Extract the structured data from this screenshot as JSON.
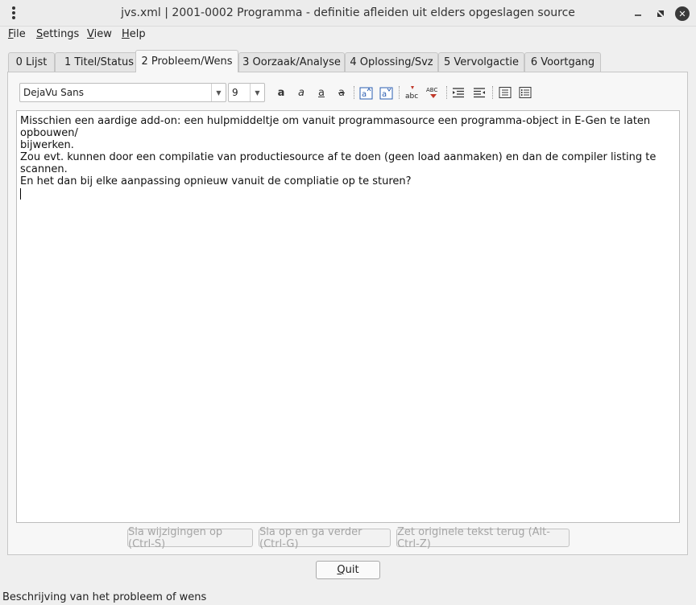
{
  "window": {
    "title": "jvs.xml | 2001-0002 Programma - definitie afleiden uit elders opgeslagen source"
  },
  "menu": [
    "File",
    "Settings",
    "View",
    "Help"
  ],
  "tabs": [
    {
      "label": "0 Lijst",
      "active": false
    },
    {
      "label": "1 Titel/Status",
      "active": false
    },
    {
      "label": "2 Probleem/Wens",
      "active": true
    },
    {
      "label": "3 Oorzaak/Analyse",
      "active": false
    },
    {
      "label": "4 Oplossing/Svz",
      "active": false
    },
    {
      "label": "5 Vervolgactie",
      "active": false
    },
    {
      "label": "6 Voortgang",
      "active": false
    }
  ],
  "toolbar": {
    "font_family": "DejaVu Sans",
    "font_size": "9",
    "icons": [
      "bold-icon",
      "italic-icon",
      "underline-icon",
      "strikethrough-icon",
      "superscript-icon",
      "subscript-icon",
      "spellcheck-lower-icon",
      "spellcheck-upper-icon",
      "indent-icon",
      "outdent-icon",
      "list-icon",
      "numbered-list-icon"
    ]
  },
  "editor": {
    "lines": [
      "Misschien een aardige add-on: een hulpmiddeltje om vanuit programmasource een programma-object in E-Gen te laten opbouwen/",
      "bijwerken.",
      "Zou evt. kunnen door een compilatie van productiesource af te doen (geen load aanmaken) en dan de compiler listing te scannen.",
      "En het dan bij elke aanpassing opnieuw vanuit de compliatie op te sturen?"
    ]
  },
  "buttons": {
    "save": "Sla wijzigingen op (Ctrl-S)",
    "save_next": "Sla op en ga verder (Ctrl-G)",
    "revert": "Zet originele tekst terug (Alt-Ctrl-Z)",
    "quit": "Quit"
  },
  "status_text": "Beschrijving van het probleem of wens",
  "colors": {
    "background": "#efefef",
    "panel": "#f7f7f7",
    "disabled_text": "#a5a5a5"
  }
}
